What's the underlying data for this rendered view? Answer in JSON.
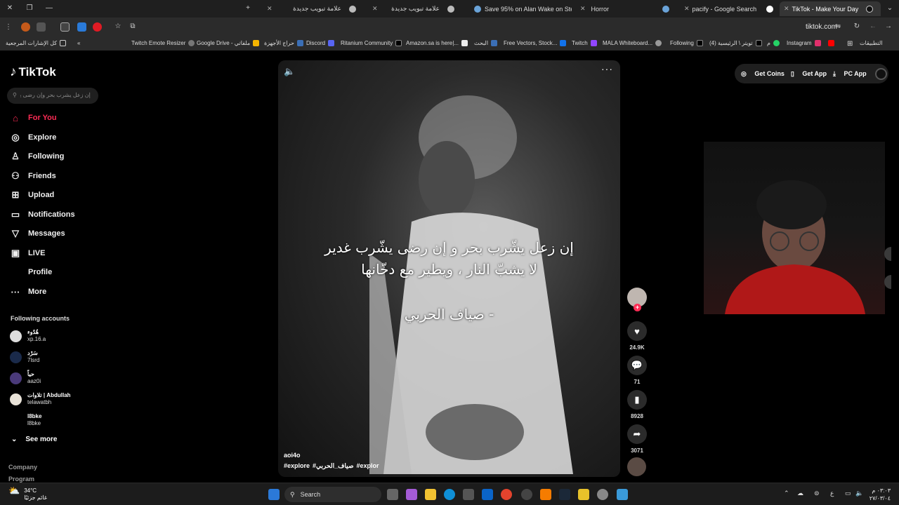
{
  "tabs": [
    {
      "title": "علامة تبويب جديدة",
      "active": false
    },
    {
      "title": "علامة تبويب جديدة",
      "active": false
    },
    {
      "title": "Save 95% on Alan Wake on Ste",
      "active": false
    },
    {
      "title": "Horror",
      "active": false
    },
    {
      "title": "pacify - Google Search",
      "active": false
    },
    {
      "title": "TikTok - Make Your Day",
      "active": true
    }
  ],
  "address": {
    "url": "tiktok.com"
  },
  "bookmarks": {
    "all_bookmarks": "كل الإشارات المرجعية",
    "items": [
      "Twitch Emote Resizer",
      "Google Drive - ملفاتي",
      "حراج الأجهزة",
      "Discord",
      "Ritanium Community",
      "Amazon.sa is here|...",
      "البحث",
      "Free Vectors, Stock...",
      "Twitch",
      "MALA Whiteboard...",
      "Following",
      "(4) تويتر \\ الرئيسية",
      "م",
      "Instagram",
      "التطبيقات"
    ]
  },
  "sidebar": {
    "logo": "TikTok",
    "search_placeholder": "إن زعل يشرب بحر وإن رضى يشرب غدير",
    "nav": [
      {
        "label": "For You",
        "icon": "home-icon"
      },
      {
        "label": "Explore",
        "icon": "compass-icon"
      },
      {
        "label": "Following",
        "icon": "following-icon"
      },
      {
        "label": "Friends",
        "icon": "friends-icon"
      },
      {
        "label": "Upload",
        "icon": "upload-icon"
      },
      {
        "label": "Notifications",
        "icon": "inbox-icon"
      },
      {
        "label": "Messages",
        "icon": "messages-icon"
      },
      {
        "label": "LIVE",
        "icon": "live-icon"
      },
      {
        "label": "Profile",
        "icon": "profile-icon"
      },
      {
        "label": "More",
        "icon": "more-icon"
      }
    ],
    "following_title": "Following accounts",
    "accounts": [
      {
        "name": "هُدُوء",
        "username": "xp.16.a"
      },
      {
        "name": "سَرْد",
        "username": "7lsrd"
      },
      {
        "name": "حياً",
        "username": "aaz0i"
      },
      {
        "name": "تلاوات | Abdullah",
        "username": "telawatbh"
      },
      {
        "name": "l8bke",
        "username": "l8bke"
      }
    ],
    "see_more": "See more",
    "footer": [
      "Company",
      "Program"
    ]
  },
  "top_actions": {
    "get_coins": "Get Coins",
    "get_app": "Get App",
    "pc_app": "PC App"
  },
  "video": {
    "caption_lines": [
      "إن زعل يشّرب بحر و إن رضى يشّرب غدير",
      "لا يشبّ النار ، ويطير مع دخّانها",
      "- صياف الحربي"
    ],
    "author": "aoi4o",
    "tags": [
      "#explore",
      "#صياف_الحربي",
      "#explor"
    ]
  },
  "actions": {
    "likes": "24.9K",
    "comments": "71",
    "saves": "8928",
    "shares": "3071"
  },
  "taskbar": {
    "temp": "34°C",
    "weather_desc": "غائم جزئيًا",
    "search": "Search",
    "lang": "ع",
    "time": "٠٣:٠٣ م",
    "date": "٢٧/٠٣/٠٤"
  },
  "colors": {
    "accent": "#fe2c55",
    "background": "#000000",
    "chrome": "#2b2b2b"
  }
}
